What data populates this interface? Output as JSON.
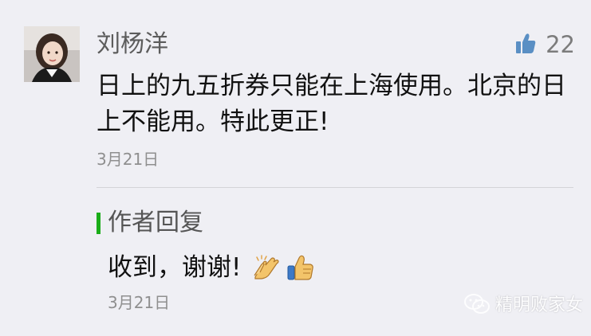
{
  "comment": {
    "username": "刘杨洋",
    "text": "日上的九五折券只能在上海使用。北京的日上不能用。特此更正!",
    "date": "3月21日",
    "likes": "22"
  },
  "reply": {
    "title": "作者回复",
    "text": "收到，谢谢!",
    "emojis": [
      "clap-icon",
      "thumbs-up-icon"
    ],
    "date": "3月21日"
  },
  "watermark": {
    "text": "精明败家女",
    "icon": "wechat-icon"
  },
  "colors": {
    "background": "#efeff4",
    "accent_green": "#1aad19",
    "like_icon": "#5a8fc4",
    "username": "#5c5c5c",
    "date": "#8f8f8f"
  }
}
